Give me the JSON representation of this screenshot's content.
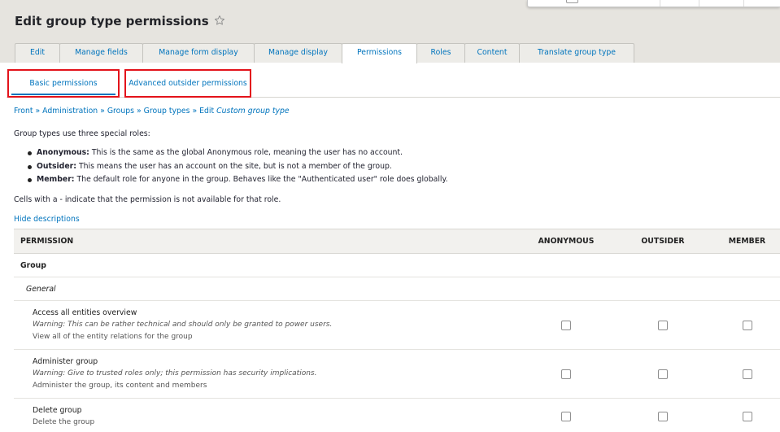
{
  "page": {
    "title": "Edit group type permissions",
    "title_icon": "star-icon"
  },
  "primary_tabs": [
    {
      "label": "Edit",
      "active": false
    },
    {
      "label": "Manage fields",
      "active": false
    },
    {
      "label": "Manage form display",
      "active": false
    },
    {
      "label": "Manage display",
      "active": false
    },
    {
      "label": "Permissions",
      "active": true
    },
    {
      "label": "Roles",
      "active": false
    },
    {
      "label": "Content",
      "active": false
    },
    {
      "label": "Translate group type",
      "active": false
    }
  ],
  "secondary_tabs": [
    {
      "label": "Basic permissions",
      "active": true,
      "highlighted": true
    },
    {
      "label": "Advanced outsider permissions",
      "active": false,
      "highlighted": true
    }
  ],
  "breadcrumb_separator": "»",
  "breadcrumb": [
    {
      "label": "Front"
    },
    {
      "label": "Administration"
    },
    {
      "label": "Groups"
    },
    {
      "label": "Group types"
    },
    {
      "label": "Edit",
      "emphasis": "Custom group type"
    }
  ],
  "intro": "Group types use three special roles:",
  "roles": [
    {
      "name": "Anonymous:",
      "text": "This is the same as the global Anonymous role, meaning the user has no account."
    },
    {
      "name": "Outsider:",
      "text": "This means the user has an account on the site, but is not a member of the group."
    },
    {
      "name": "Member:",
      "text": "The default role for anyone in the group. Behaves like the \"Authenticated user\" role does globally."
    }
  ],
  "note": "Cells with a - indicate that the permission is not available for that role.",
  "hide_descriptions_link": "Hide descriptions",
  "table": {
    "headers": {
      "permission": "PERMISSION",
      "anonymous": "ANONYMOUS",
      "outsider": "OUTSIDER",
      "member": "MEMBER"
    },
    "module": "Group",
    "section": "General",
    "permissions": [
      {
        "title": "Access all entities overview",
        "warning": "Warning: This can be rather technical and should only be granted to power users.",
        "description": "View all of the entity relations for the group",
        "anonymous": false,
        "outsider": false,
        "member": false
      },
      {
        "title": "Administer group",
        "warning": "Warning: Give to trusted roles only; this permission has security implications.",
        "description": "Administer the group, its content and members",
        "anonymous": false,
        "outsider": false,
        "member": false
      },
      {
        "title": "Delete group",
        "description": "Delete the group",
        "anonymous": false,
        "outsider": false,
        "member": false
      }
    ]
  },
  "colors": {
    "link": "#0074bd",
    "header_background": "#e6e4df",
    "annotation_highlight": "#e3131b",
    "text": "#222330"
  }
}
